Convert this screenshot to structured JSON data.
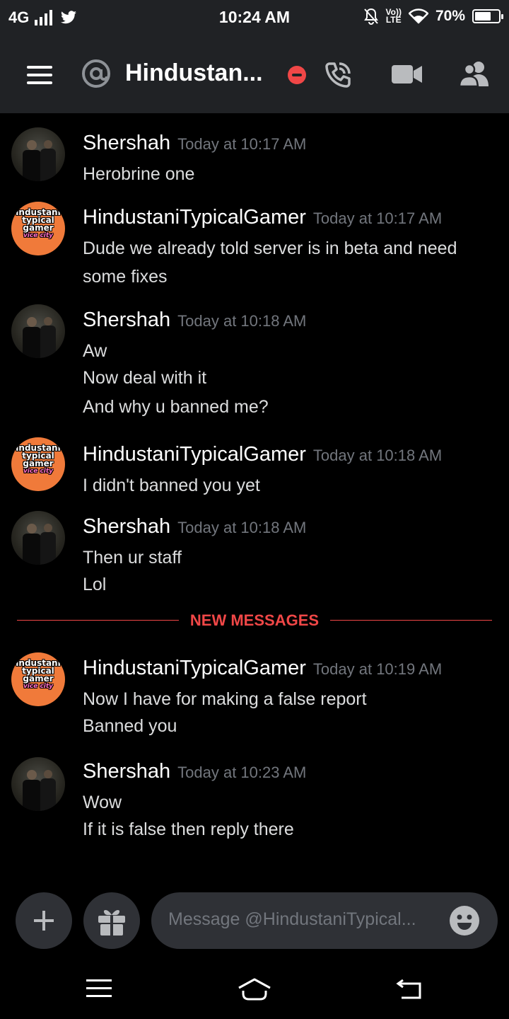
{
  "status_bar": {
    "network": "4G",
    "time": "10:24 AM",
    "volte_top": "Vo))",
    "volte_bottom": "LTE",
    "battery": "70%",
    "battery_level": 0.7
  },
  "header": {
    "title": "Hindustan..."
  },
  "messages": [
    {
      "author": "Shershah",
      "timestamp": "Today at 10:17 AM",
      "lines": [
        "Herobrine one"
      ]
    },
    {
      "author": "HindustaniTypicalGamer",
      "timestamp": "Today at 10:17 AM",
      "lines": [
        "Dude we already told server is in beta and need",
        "some fixes"
      ]
    },
    {
      "author": "Shershah",
      "timestamp": "Today at 10:18 AM",
      "lines": [
        "Aw",
        "Now deal with it",
        "And why u banned me?"
      ]
    },
    {
      "author": "HindustaniTypicalGamer",
      "timestamp": "Today at 10:18 AM",
      "lines": [
        "I didn't banned you yet"
      ]
    },
    {
      "author": "Shershah",
      "timestamp": "Today at 10:18 AM",
      "lines": [
        "Then ur staff",
        "Lol"
      ]
    },
    {
      "author": "HindustaniTypicalGamer",
      "timestamp": "Today at 10:19 AM",
      "lines": [
        "Now I have for making a false report",
        "Banned you"
      ]
    },
    {
      "author": "Shershah",
      "timestamp": "Today at 10:23 AM",
      "lines": [
        "Wow",
        "If it is false then reply there"
      ]
    }
  ],
  "divider": {
    "label": "NEW MESSAGES"
  },
  "avatar_logo": {
    "l1": "ındustanı",
    "l2": "typical",
    "l3": "gamer",
    "l4": "vice city"
  },
  "composer": {
    "placeholder": "Message @HindustaniTypical..."
  },
  "colors": {
    "background": "#000000",
    "header": "#202225",
    "input": "#2f3136",
    "accent_red": "#f04747",
    "muted": "#72767d"
  },
  "icons": {
    "menu": "hamburger-icon",
    "dm": "at-icon",
    "status": "dnd-icon",
    "call": "phone-call-icon",
    "video": "video-camera-icon",
    "members": "members-icon",
    "add": "plus-icon",
    "gift": "gift-icon",
    "emoji": "emoji-icon"
  }
}
